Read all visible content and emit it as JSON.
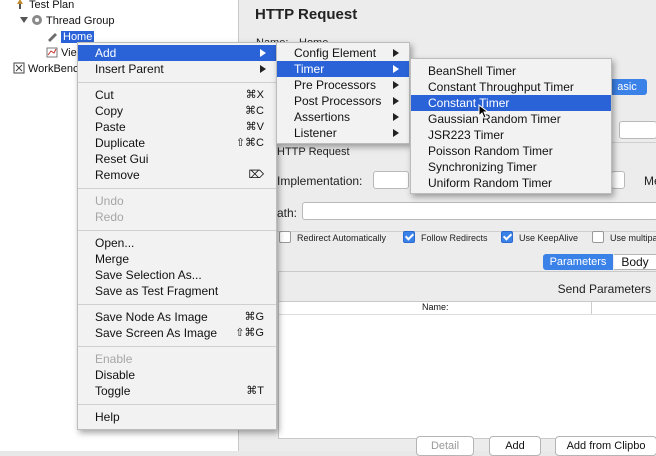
{
  "tree": {
    "items": [
      "Test Plan",
      "Thread Group",
      "Home",
      "Vie",
      "WorkBenc"
    ]
  },
  "panel": {
    "title": "HTTP Request",
    "name_label": "Name:",
    "name_value": "Home",
    "basic_tab": "asic",
    "group_label": "HTTP Request",
    "implementation_label": "Implementation:",
    "m_label": "Me",
    "path_label": "ath:",
    "checkboxes": [
      {
        "label": "Redirect Automatically",
        "checked": false
      },
      {
        "label": "Follow Redirects",
        "checked": true
      },
      {
        "label": "Use KeepAlive",
        "checked": true
      },
      {
        "label": "Use multipa",
        "checked": false
      }
    ],
    "tabs": [
      "Parameters",
      "Body"
    ],
    "send_params": "Send Parameters",
    "table_header": "Name:",
    "buttons": [
      "Detail",
      "Add",
      "Add from Clipbo"
    ]
  },
  "context_menu": {
    "items": [
      {
        "label": "Add",
        "submenu": true,
        "highlight": true
      },
      {
        "label": "Insert Parent",
        "submenu": true
      },
      {
        "label": "Cut",
        "shortcut": "⌘X"
      },
      {
        "label": "Copy",
        "shortcut": "⌘C"
      },
      {
        "label": "Paste",
        "shortcut": "⌘V"
      },
      {
        "label": "Duplicate",
        "shortcut": "⇧⌘C"
      },
      {
        "label": "Reset Gui"
      },
      {
        "label": "Remove",
        "shortcut": "⌦"
      },
      {
        "label": "Undo",
        "disabled": true
      },
      {
        "label": "Redo",
        "disabled": true
      },
      {
        "label": "Open..."
      },
      {
        "label": "Merge"
      },
      {
        "label": "Save Selection As..."
      },
      {
        "label": "Save as Test Fragment"
      },
      {
        "label": "Save Node As Image",
        "shortcut": "⌘G"
      },
      {
        "label": "Save Screen As Image",
        "shortcut": "⇧⌘G"
      },
      {
        "label": "Enable",
        "disabled": true
      },
      {
        "label": "Disable"
      },
      {
        "label": "Toggle",
        "shortcut": "⌘T"
      },
      {
        "label": "Help"
      }
    ]
  },
  "add_menu": {
    "items": [
      "Config Element",
      "Timer",
      "Pre Processors",
      "Post Processors",
      "Assertions",
      "Listener"
    ]
  },
  "timer_menu": {
    "items": [
      "BeanShell Timer",
      "Constant Throughput Timer",
      "Constant Timer",
      "Gaussian Random Timer",
      "JSR223 Timer",
      "Poisson Random Timer",
      "Synchronizing Timer",
      "Uniform Random Timer"
    ]
  },
  "colors": {
    "highlight": "#2a63d8",
    "menu_bg": "#f2f2f2"
  }
}
